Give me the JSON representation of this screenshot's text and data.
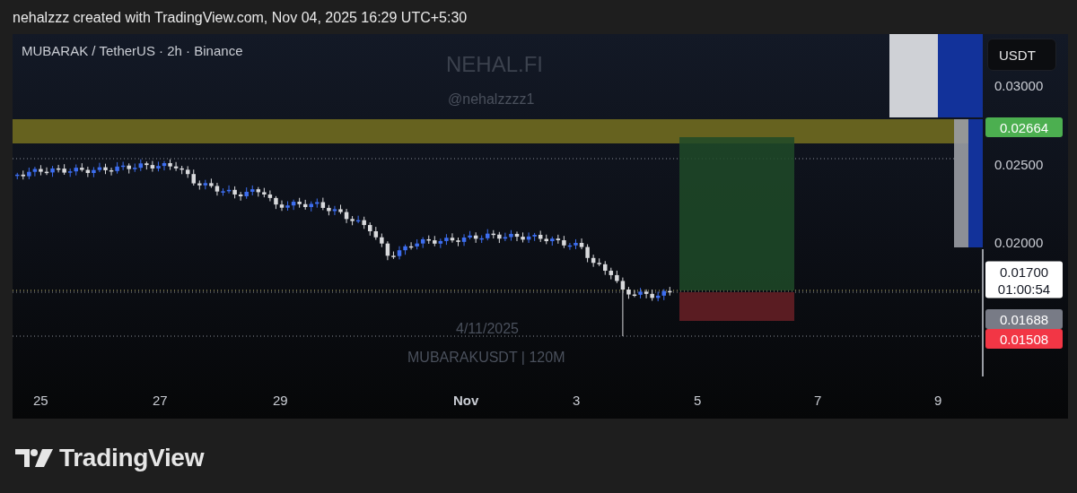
{
  "header": {
    "caption": "nehalzzz created with TradingView.com, Nov 04, 2025 16:29 UTC+5:30"
  },
  "chart": {
    "symbol_title": "MUBARAK / TetherUS · 2h · Binance",
    "watermarks": [
      {
        "text": "NEHAL.FI",
        "kind": "large"
      },
      {
        "text": "@nehalzzzz1",
        "kind": "small"
      },
      {
        "text": "4/11/2025",
        "kind": "small"
      },
      {
        "text": "MUBARAKUSDT | 120M",
        "kind": "small"
      }
    ],
    "currency_button": "USDT",
    "price_ticks": [
      {
        "label": "0.03000"
      },
      {
        "label": "0.02500"
      },
      {
        "label": "0.02000"
      }
    ],
    "price_badges": [
      {
        "label": "0.02664",
        "color": "#4caf50"
      },
      {
        "label": "0.01700",
        "countdown": "01:00:54",
        "color": "#ffffff"
      },
      {
        "label": "0.01688",
        "color": "#787b86"
      },
      {
        "label": "0.01508",
        "color": "#f23645"
      }
    ],
    "time_ticks": [
      {
        "label": "25",
        "kind": "day"
      },
      {
        "label": "27",
        "kind": "day"
      },
      {
        "label": "29",
        "kind": "day"
      },
      {
        "label": "Nov",
        "kind": "month"
      },
      {
        "label": "3",
        "kind": "day"
      },
      {
        "label": "5",
        "kind": "day"
      },
      {
        "label": "7",
        "kind": "day"
      },
      {
        "label": "9",
        "kind": "day"
      }
    ]
  },
  "footer": {
    "logo_text": "TradingView"
  }
}
